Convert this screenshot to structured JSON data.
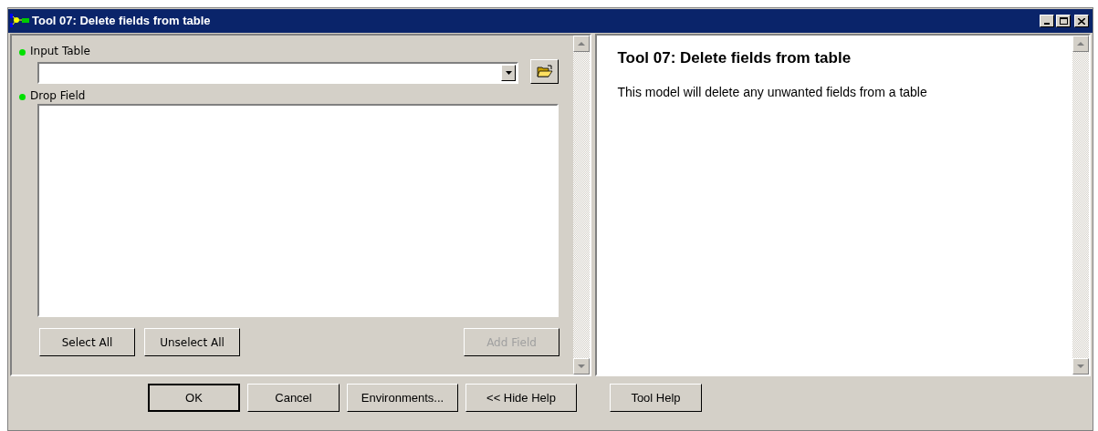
{
  "window": {
    "title": "Tool 07: Delete fields from table"
  },
  "parameters": [
    {
      "kind": "combo",
      "label": "Input Table"
    },
    {
      "kind": "list",
      "label": "Drop Field"
    }
  ],
  "list_buttons": [
    {
      "label": "Select All",
      "disabled": false
    },
    {
      "label": "Unselect All",
      "disabled": false
    },
    {
      "label": "Add Field",
      "disabled": true
    }
  ],
  "help": {
    "title": "Tool 07: Delete fields from table",
    "text": "This model will delete any unwanted fields from a table"
  },
  "buttons": [
    {
      "label": "OK",
      "default": true
    },
    {
      "label": "Cancel",
      "default": false
    },
    {
      "label": "Environments...",
      "default": false
    },
    {
      "label": "<< Hide Help",
      "default": false
    },
    {
      "label": "Tool Help",
      "default": false
    }
  ]
}
